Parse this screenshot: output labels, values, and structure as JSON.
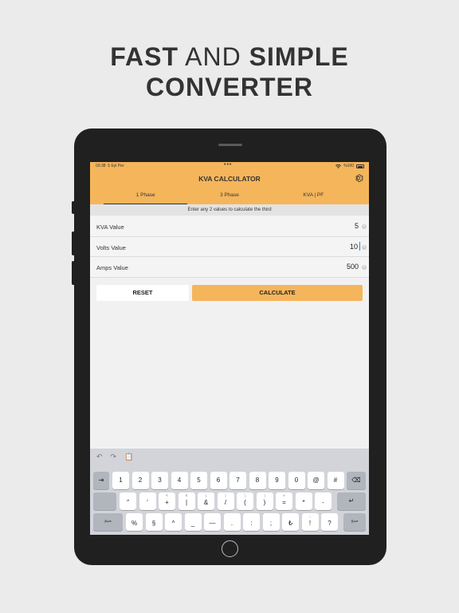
{
  "headline": {
    "line1_bold_a": "FAST",
    "line1_light": " AND ",
    "line1_bold_b": "SIMPLE",
    "line2": "CONVERTER"
  },
  "status_bar": {
    "time": "03:38",
    "date": "5 Eyl Per",
    "battery": "%100"
  },
  "app": {
    "title": "KVA CALCULATOR",
    "settings_icon": "gear-icon",
    "tabs": [
      {
        "label": "1 Phase",
        "active": true
      },
      {
        "label": "3 Phase",
        "active": false
      },
      {
        "label": "KVA | PF",
        "active": false
      }
    ],
    "hint": "Enter any 2 values to calculate the third",
    "fields": [
      {
        "label": "KVA Value",
        "value": "5"
      },
      {
        "label": "Volts Value",
        "value": "10"
      },
      {
        "label": "Amps Value",
        "value": "500"
      }
    ],
    "reset_label": "RESET",
    "calculate_label": "CALCULATE"
  },
  "keyboard": {
    "tools": {
      "undo": "↶",
      "redo": "↷",
      "paste": "📋"
    },
    "row1": {
      "tab": "⇥",
      "keys": [
        "1",
        "2",
        "3",
        "4",
        "5",
        "6",
        "7",
        "8",
        "9",
        "0",
        "@",
        "#"
      ],
      "delete": "⌫"
    },
    "row2": {
      "keys": [
        {
          "sub": "",
          "main": "″"
        },
        {
          "sub": "",
          "main": "′"
        },
        {
          "sub": "€",
          "main": "+"
        },
        {
          "sub": "$",
          "main": "|"
        },
        {
          "sub": "{",
          "main": "&"
        },
        {
          "sub": "}",
          "main": "/"
        },
        {
          "sub": "[",
          "main": "("
        },
        {
          "sub": "]",
          "main": ")"
        },
        {
          "sub": "≠",
          "main": "="
        },
        {
          "sub": "",
          "main": "*"
        },
        {
          "sub": "",
          "main": "-"
        }
      ],
      "return": "↵"
    },
    "row3": {
      "left_mode": "#+=",
      "keys": [
        {
          "sub": "",
          "main": "%"
        },
        {
          "sub": "",
          "main": "§"
        },
        {
          "sub": "",
          "main": "^"
        },
        {
          "sub": "",
          "main": "_"
        },
        {
          "sub": "",
          "main": "—"
        },
        {
          "sub": "",
          "main": "."
        },
        {
          "sub": "",
          "main": ":"
        },
        {
          "sub": "",
          "main": ";"
        },
        {
          "sub": "",
          "main": "₺"
        },
        {
          "sub": "¡",
          "main": "!"
        },
        {
          "sub": "",
          "main": "?"
        }
      ],
      "right_mode": "#+="
    }
  },
  "colors": {
    "accent": "#f5b55b",
    "background": "#ebebeb",
    "device": "#202020"
  }
}
